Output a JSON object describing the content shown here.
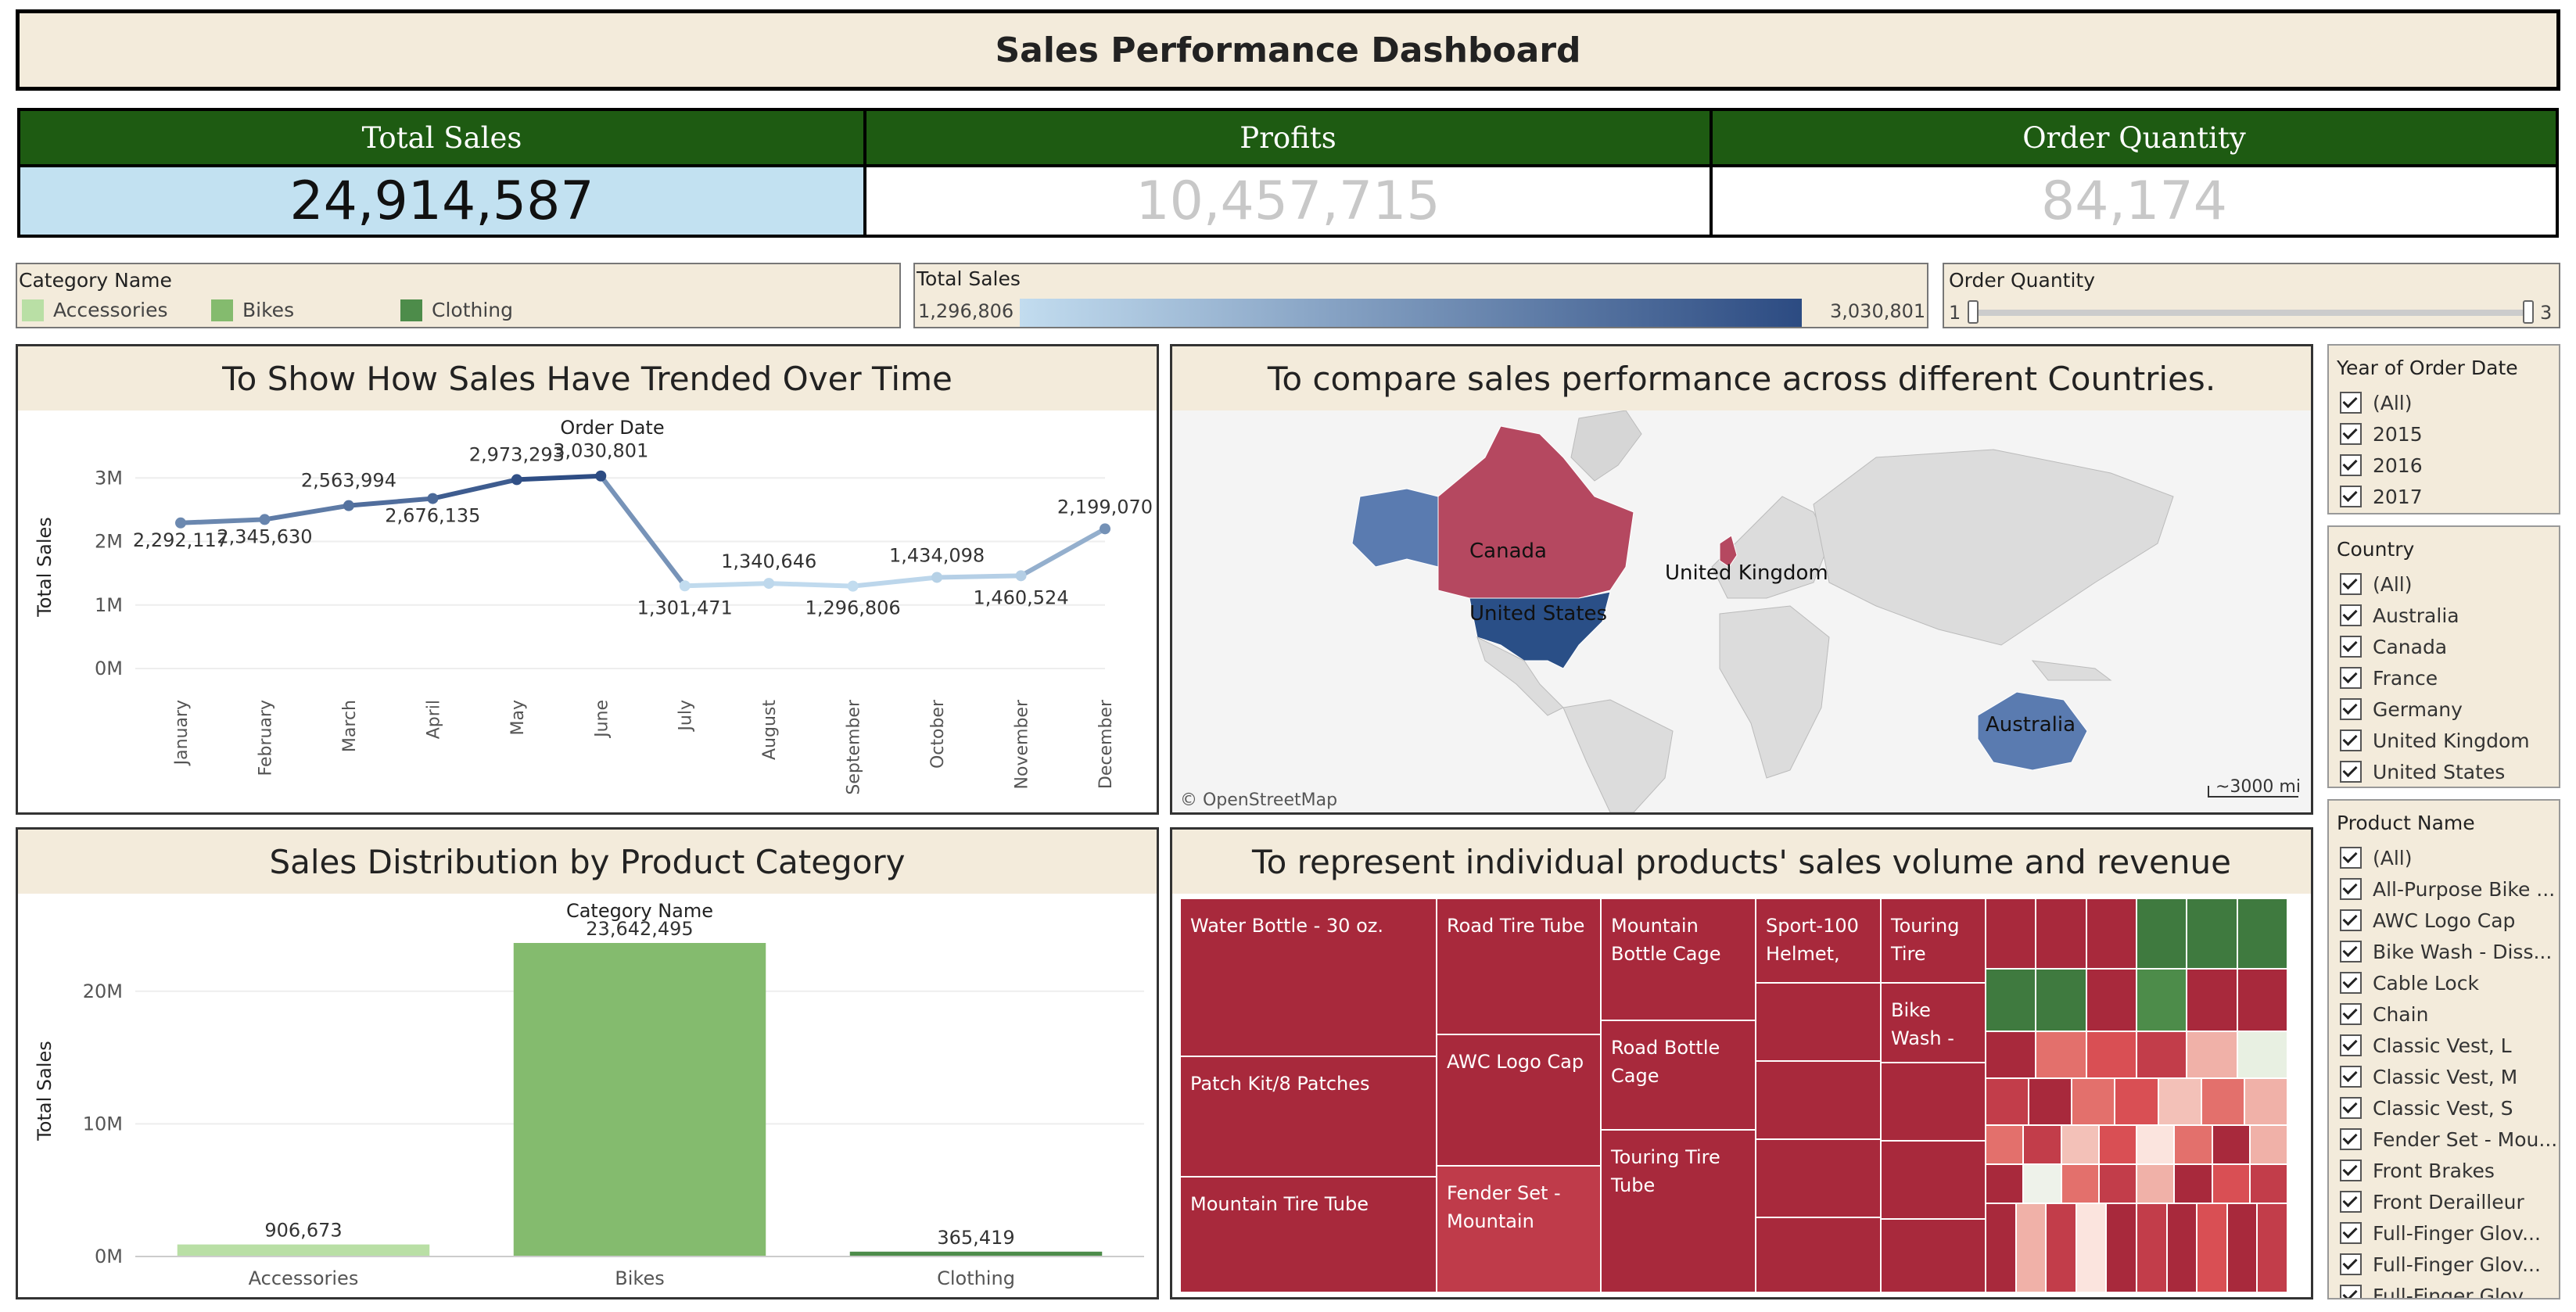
{
  "title": "Sales Performance Dashboard",
  "kpis": [
    {
      "label": "Total Sales",
      "value": "24,914,587"
    },
    {
      "label": "Profits",
      "value": "10,457,715"
    },
    {
      "label": "Order Quantity",
      "value": "84,174"
    }
  ],
  "legends": {
    "category": {
      "title": "Category Name",
      "items": [
        {
          "label": "Accessories",
          "color": "#b9dfa5"
        },
        {
          "label": "Bikes",
          "color": "#84bb6e"
        },
        {
          "label": "Clothing",
          "color": "#4d8c4a"
        }
      ]
    },
    "total_sales": {
      "title": "Total Sales",
      "min": "1,296,806",
      "max": "3,030,801"
    },
    "order_quantity": {
      "title": "Order Quantity",
      "min": "1",
      "max": "3"
    }
  },
  "line_panel": {
    "title": "To Show How Sales Have Trended Over Time",
    "header": "Order Date"
  },
  "map_panel": {
    "title": "To compare sales performance across different Countries.",
    "labels": [
      "Canada",
      "United States",
      "United Kingdom",
      "Australia"
    ],
    "attribution": "© OpenStreetMap",
    "scale": "~3000 mi"
  },
  "bar_panel": {
    "title": "Sales Distribution by Product Category",
    "header": "Category Name"
  },
  "treemap_panel": {
    "title": "To represent individual products' sales volume and revenue",
    "labels": [
      "Water Bottle - 30 oz.",
      "Patch Kit/8 Patches",
      "Mountain Tire Tube",
      "Road Tire Tube",
      "AWC Logo Cap",
      "Fender Set - Mountain",
      "Mountain Bottle Cage",
      "Road Bottle Cage",
      "Touring Tire Tube",
      "Sport-100 Helmet,",
      "Touring Tire",
      "Bike Wash -"
    ]
  },
  "filters": {
    "year": {
      "title": "Year of Order Date",
      "items": [
        "(All)",
        "2015",
        "2016",
        "2017"
      ]
    },
    "country": {
      "title": "Country",
      "items": [
        "(All)",
        "Australia",
        "Canada",
        "France",
        "Germany",
        "United Kingdom",
        "United States"
      ]
    },
    "product": {
      "title": "Product Name",
      "items": [
        "(All)",
        "All-Purpose Bike ...",
        "AWC Logo Cap",
        "Bike Wash - Diss...",
        "Cable Lock",
        "Chain",
        "Classic Vest, L",
        "Classic Vest, M",
        "Classic Vest, S",
        "Fender Set - Mou...",
        "Front Brakes",
        "Front Derailleur",
        "Full-Finger Glov...",
        "Full-Finger Glov...",
        "Full-Finger Glov..."
      ]
    }
  },
  "chart_data": [
    {
      "type": "line",
      "title": "To Show How Sales Have Trended Over Time",
      "header": "Order Date",
      "xlabel": "",
      "ylabel": "Total Sales",
      "categories": [
        "January",
        "February",
        "March",
        "April",
        "May",
        "June",
        "July",
        "August",
        "September",
        "October",
        "November",
        "December"
      ],
      "values": [
        2292117,
        2345630,
        2563994,
        2676135,
        2973293,
        3030801,
        1301471,
        1340646,
        1296806,
        1434098,
        1460524,
        2199070
      ],
      "data_labels": [
        "2,292,117",
        "2,345,630",
        "2,563,994",
        "2,676,135",
        "2,973,293",
        "3,030,801",
        "1,301,471",
        "1,340,646",
        "1,296,806",
        "1,434,098",
        "1,460,524",
        "2,199,070"
      ],
      "yticks": [
        "0M",
        "1M",
        "2M",
        "3M"
      ],
      "ylim": [
        0,
        3200000
      ],
      "grid": true
    },
    {
      "type": "bar",
      "title": "Sales Distribution by Product Category",
      "header": "Category Name",
      "xlabel": "",
      "ylabel": "Total Sales",
      "categories": [
        "Accessories",
        "Bikes",
        "Clothing"
      ],
      "values": [
        906673,
        23642495,
        365419
      ],
      "data_labels": [
        "906,673",
        "23,642,495",
        "365,419"
      ],
      "colors": [
        "#b9dfa5",
        "#84bb6e",
        "#4d8c4a"
      ],
      "yticks": [
        "0M",
        "10M",
        "20M"
      ],
      "ylim": [
        0,
        25000000
      ],
      "grid": true
    }
  ]
}
